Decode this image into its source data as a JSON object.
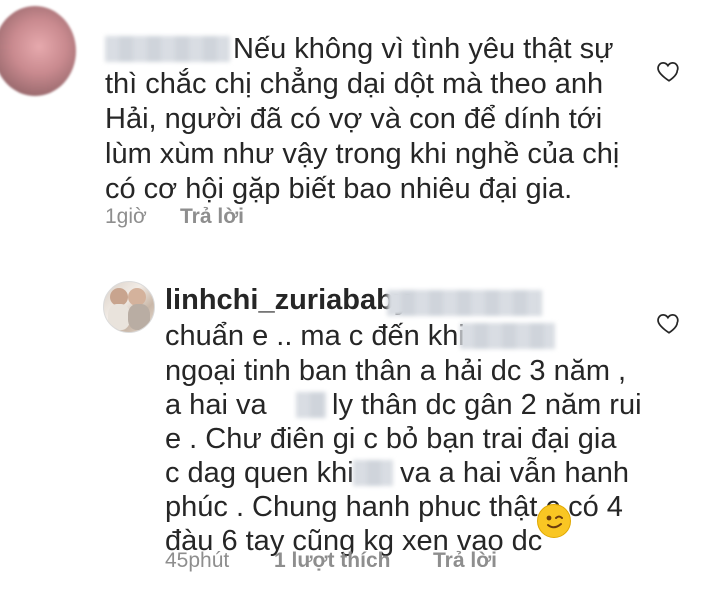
{
  "comments": [
    {
      "text_lines": [
        "Nếu không vì tình yêu thật sự",
        "thì chắc chị chẳng dại dột mà theo anh",
        "Hải, người đã có vợ và con để dính tới",
        "lùm xùm như vậy trong khi nghề của chị",
        "có cơ hội gặp biết bao nhiêu đại gia."
      ],
      "time": "1giờ",
      "reply_label": "Trả lời"
    },
    {
      "username": "linhchi_zuriababy",
      "text_lines": [
        "chuẩn e .. ma c đến khi",
        "ngoại tinh ban thân a hải dc 3 năm ,",
        "a hai va",
        "ly thân dc gân 2 năm rui",
        "e . Chư điên gi c bỏ bạn trai đại gia",
        "c dag quen khi",
        "va a hai vẫn hanh",
        "phúc . Chung hanh phuc thật c có 4",
        "đàu 6 tay cũng kg xen vao dc"
      ],
      "emoji": "winking-face-emoji",
      "time": "45phút",
      "likes_label": "1 lượt thích",
      "reply_label": "Trả lời"
    }
  ]
}
